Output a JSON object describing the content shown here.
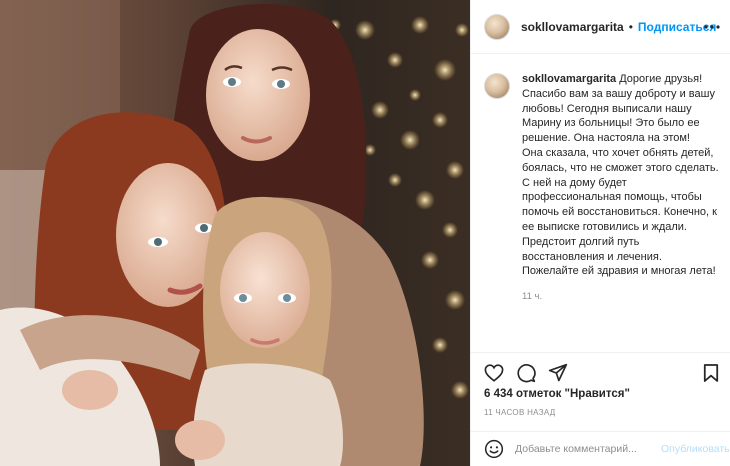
{
  "post": {
    "username": "sokllovamargarita",
    "dot": "•",
    "follow_label": "Подписаться",
    "caption_author": "sokllovamargarita",
    "caption_text": " Дорогие друзья! Спасибо вам за вашу доброту и вашу любовь! Сегодня выписали нашу Марину из больницы! Это было ее решение. Она настояла на этом!\nОна сказала, что хочет обнять детей, боялась, что не сможет этого сделать.\nС ней на дому будет профессиональная помощь, чтобы помочь ей восстановиться. Конечно, к ее выписке готовились и ждали. Предстоит долгий путь восстановления и лечения. Пожелайте ей здравия и многая лета!",
    "caption_time": "11 ч.",
    "likes": "6 434 отметок \"Нравится\"",
    "posted_ago": "11 ЧАСОВ НАЗАД"
  },
  "comment": {
    "placeholder": "Добавьте комментарий...",
    "publish_label": "Опубликовать"
  },
  "icons": {
    "more": "more-icon",
    "like": "heart-icon",
    "comment": "comment-icon",
    "share": "paper-plane-icon",
    "save": "bookmark-icon",
    "emoji": "emoji-icon"
  },
  "colors": {
    "accent": "#0095f6",
    "publish_disabled": "#b2dffc",
    "muted": "#8e8e8e",
    "text": "#262626",
    "border": "#efefef"
  }
}
